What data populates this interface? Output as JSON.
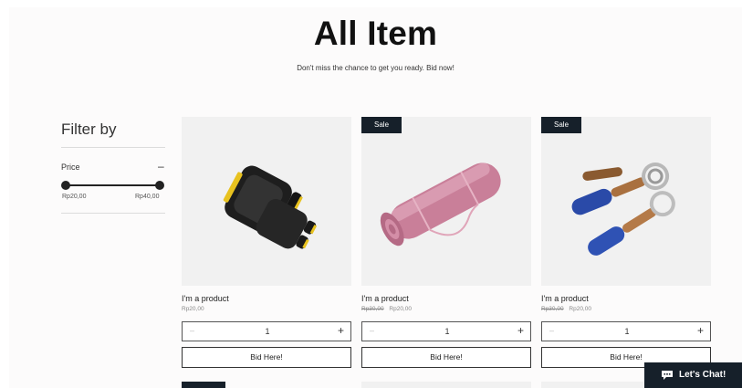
{
  "header": {
    "title": "All Item",
    "subtitle": "Don't miss the chance to get you ready. Bid now!"
  },
  "filter": {
    "title": "Filter by",
    "price_label": "Price",
    "collapse_symbol": "–",
    "range_min": "Rp20,00",
    "range_max": "Rp40,00"
  },
  "products": [
    {
      "name": "I'm a product",
      "old_price": "",
      "price": "Rp20,00",
      "sale": false,
      "sale_label": "",
      "image": "gloves-image",
      "quantity": "1",
      "button_label": "Bid Here!"
    },
    {
      "name": "I'm a product",
      "old_price": "Rp30,00",
      "price": "Rp20,00",
      "sale": true,
      "sale_label": "Sale",
      "image": "yoga-mat-image",
      "quantity": "1",
      "button_label": "Bid Here!"
    },
    {
      "name": "I'm a product",
      "old_price": "Rp30,00",
      "price": "Rp20,00",
      "sale": true,
      "sale_label": "Sale",
      "image": "hand-grips-image",
      "quantity": "1",
      "button_label": "Bid Here!"
    }
  ],
  "qty_controls": {
    "minus": "–",
    "plus": "+"
  },
  "chat": {
    "label": "Let's Chat!",
    "icon": "chat-bubble-icon"
  },
  "colors": {
    "dark": "#16202a",
    "card_bg": "#f1f1f1",
    "page_bg": "#fcfbfb"
  }
}
